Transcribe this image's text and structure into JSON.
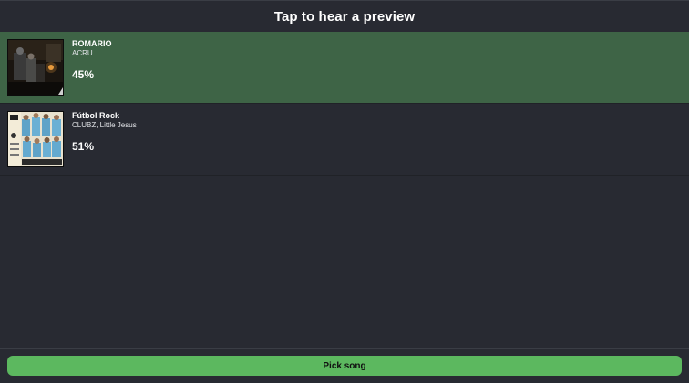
{
  "header": {
    "title": "Tap to hear a preview"
  },
  "songs": [
    {
      "title": "ROMARIO",
      "artist": "ACRU",
      "percent": "45%",
      "selected": true,
      "cover_icon": "album-art-romario"
    },
    {
      "title": "Fútbol Rock",
      "artist": "CLUBZ, Little Jesus",
      "percent": "51%",
      "selected": false,
      "cover_icon": "album-art-futbol-rock"
    }
  ],
  "footer": {
    "pick_label": "Pick song"
  },
  "colors": {
    "background": "#282a32",
    "selected_row": "#3e6446",
    "button": "#5cb85f"
  }
}
